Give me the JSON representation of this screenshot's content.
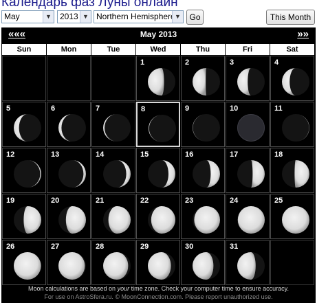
{
  "page": {
    "title": "Календарь фаз Луны онлайн"
  },
  "controls": {
    "month_value": "May",
    "year_value": "2013",
    "hemisphere_value": "Northern Hemisphere",
    "go_label": "Go",
    "this_month_label": "This Month"
  },
  "calendar": {
    "prev_label": "«««",
    "next_label": "»»",
    "month_title": "May 2013",
    "weekdays": [
      "Sun",
      "Mon",
      "Tue",
      "Wed",
      "Thu",
      "Fri",
      "Sat"
    ],
    "today": 8,
    "colors": {
      "background": "#000000",
      "moon_light": "#dcdcdc",
      "moon_dark": "#141414",
      "new_moon": "#2a2a30"
    },
    "weeks": [
      [
        null,
        null,
        null,
        1,
        2,
        3,
        4
      ],
      [
        5,
        6,
        7,
        8,
        9,
        10,
        11
      ],
      [
        12,
        13,
        14,
        15,
        16,
        17,
        18
      ],
      [
        19,
        20,
        21,
        22,
        23,
        24,
        25
      ],
      [
        26,
        27,
        28,
        29,
        30,
        31,
        null
      ]
    ],
    "phases": {
      "1": {
        "illum": 0.59,
        "waxing": false
      },
      "2": {
        "illum": 0.48,
        "waxing": false
      },
      "3": {
        "illum": 0.38,
        "waxing": false
      },
      "4": {
        "illum": 0.28,
        "waxing": false
      },
      "5": {
        "illum": 0.19,
        "waxing": false
      },
      "6": {
        "illum": 0.11,
        "waxing": false
      },
      "7": {
        "illum": 0.05,
        "waxing": false
      },
      "8": {
        "illum": 0.02,
        "waxing": false
      },
      "9": {
        "illum": 0.01,
        "waxing": false
      },
      "10": {
        "illum": 0.0,
        "waxing": true
      },
      "11": {
        "illum": 0.01,
        "waxing": true
      },
      "12": {
        "illum": 0.04,
        "waxing": true
      },
      "13": {
        "illum": 0.09,
        "waxing": true
      },
      "14": {
        "illum": 0.16,
        "waxing": true
      },
      "15": {
        "illum": 0.25,
        "waxing": true
      },
      "16": {
        "illum": 0.34,
        "waxing": true
      },
      "17": {
        "illum": 0.44,
        "waxing": true
      },
      "18": {
        "illum": 0.54,
        "waxing": true
      },
      "19": {
        "illum": 0.64,
        "waxing": true
      },
      "20": {
        "illum": 0.73,
        "waxing": true
      },
      "21": {
        "illum": 0.81,
        "waxing": true
      },
      "22": {
        "illum": 0.88,
        "waxing": true
      },
      "23": {
        "illum": 0.94,
        "waxing": true
      },
      "24": {
        "illum": 0.98,
        "waxing": true
      },
      "25": {
        "illum": 1.0,
        "waxing": true
      },
      "26": {
        "illum": 0.99,
        "waxing": false
      },
      "27": {
        "illum": 0.96,
        "waxing": false
      },
      "28": {
        "illum": 0.91,
        "waxing": false
      },
      "29": {
        "illum": 0.84,
        "waxing": false
      },
      "30": {
        "illum": 0.76,
        "waxing": false
      },
      "31": {
        "illum": 0.67,
        "waxing": false
      }
    }
  },
  "footer": {
    "line1_prefix": "Moon calculations are based on ",
    "line1_emph": "your",
    "line1_suffix": " time zone. Check your computer time to ensure accuracy.",
    "line2": "For use on AstroSfera.ru. © MoonConnection.com. Please report unauthorized use."
  }
}
